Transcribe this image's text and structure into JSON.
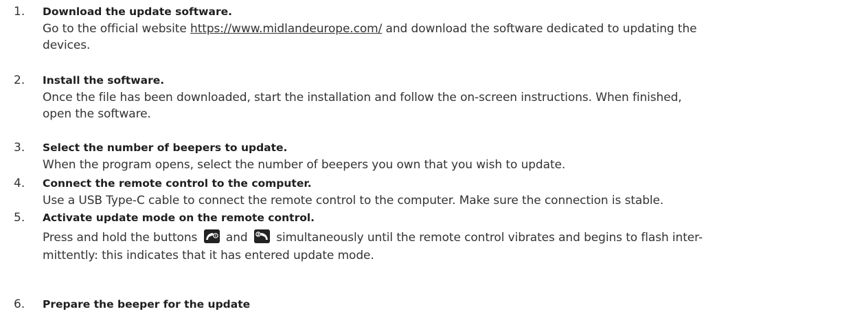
{
  "steps": [
    {
      "number": "1.",
      "title": "Download the update software.",
      "desc_before": "Go to the official website ",
      "link_text": "https://www.midlandeurope.com/",
      "desc_after_line1": " and download the software dedicated to updating the",
      "desc_line2": "devices."
    },
    {
      "number": "2.",
      "title": "Install the software.",
      "desc_line1": "Once the file has been downloaded, start the installation and follow the on-screen instructions. When finished,",
      "desc_line2": "open the software."
    },
    {
      "number": "3.",
      "title": "Select the number of beepers to update.",
      "desc_line1": "When the program opens, select the number of beepers you own that you wish to update."
    },
    {
      "number": "4.",
      "title": "Connect the remote control to the computer.",
      "desc_line1": "Use a USB Type-C cable to connect the remote control to the computer. Make sure the connection is stable."
    },
    {
      "number": "5.",
      "title": "Activate update mode on the remote control.",
      "desc_part1": "Press and hold the buttons",
      "desc_part2": "and",
      "desc_part3": "simultaneously until the remote control vibrates and begins to flash inter-",
      "desc_line2": "mittently: this indicates that it has entered update mode.",
      "icons": [
        "remote-button-1-icon",
        "remote-button-2-icon"
      ]
    },
    {
      "number": "6.",
      "title": "Prepare the beeper for the update"
    }
  ]
}
